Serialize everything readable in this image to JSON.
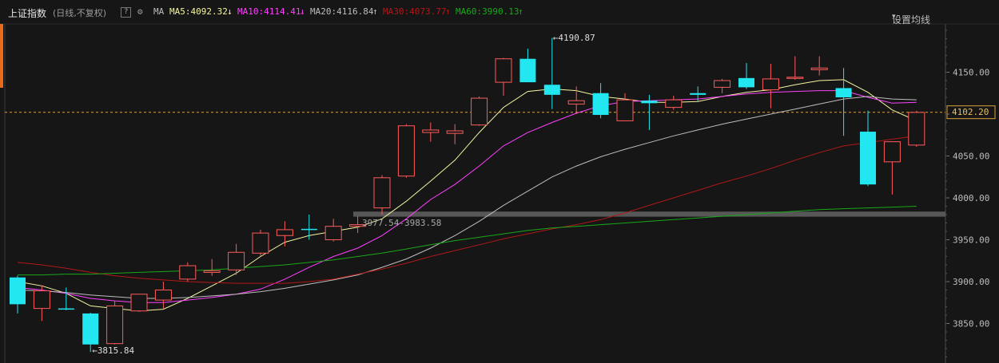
{
  "header": {
    "index_name": "上证指数",
    "mode": "(日线,不复权)",
    "help": "?",
    "ma_label": "MA",
    "ma5": {
      "text": "MA5:4092.32",
      "arrow": "↓",
      "color": "#f5f5a0"
    },
    "ma10": {
      "text": "MA10:4114.41",
      "arrow": "↓",
      "color": "#ff40ff"
    },
    "ma20": {
      "text": "MA20:4116.84",
      "arrow": "↑",
      "color": "#bdbdbd"
    },
    "ma30": {
      "text": "MA30:4073.77",
      "arrow": "↑",
      "color": "#b01818"
    },
    "ma60": {
      "text": "MA60:3990.13",
      "arrow": "↑",
      "color": "#18a818"
    },
    "settings": "设置均线"
  },
  "annotations": {
    "high": "4190.87",
    "low": "3815.84",
    "band": "3977.54-3983.58",
    "current": "4102.20"
  },
  "chart_data": {
    "type": "candlestick",
    "title": "上证指数",
    "ylim": [
      3800,
      4210
    ],
    "yticks": [
      3850,
      3900,
      3950,
      4000,
      4050,
      4100,
      4150
    ],
    "ytick_labels": [
      "3850.00",
      "3900.00",
      "3950.00",
      "4000.00",
      "4050.00",
      "",
      "4150.00"
    ],
    "current_price": 4102.2,
    "band": [
      3977.54,
      3983.58
    ],
    "high_marker": {
      "index": 22,
      "value": 4190.87
    },
    "low_marker": {
      "index": 3,
      "value": 3815.84
    },
    "candles": [
      {
        "o": 3905,
        "h": 3907,
        "l": 3862,
        "c": 3873
      },
      {
        "o": 3868,
        "h": 3895,
        "l": 3853,
        "c": 3889
      },
      {
        "o": 3868,
        "h": 3893,
        "l": 3866,
        "c": 3867
      },
      {
        "o": 3862,
        "h": 3863,
        "l": 3816,
        "c": 3825
      },
      {
        "o": 3826,
        "h": 3877,
        "l": 3825,
        "c": 3871
      },
      {
        "o": 3865,
        "h": 3885,
        "l": 3864,
        "c": 3885
      },
      {
        "o": 3878,
        "h": 3900,
        "l": 3868,
        "c": 3890
      },
      {
        "o": 3903,
        "h": 3923,
        "l": 3900,
        "c": 3919
      },
      {
        "o": 3911,
        "h": 3927,
        "l": 3907,
        "c": 3913
      },
      {
        "o": 3914,
        "h": 3945,
        "l": 3908,
        "c": 3935
      },
      {
        "o": 3934,
        "h": 3962,
        "l": 3931,
        "c": 3958
      },
      {
        "o": 3955,
        "h": 3972,
        "l": 3942,
        "c": 3962
      },
      {
        "o": 3963,
        "h": 3980,
        "l": 3950,
        "c": 3962
      },
      {
        "o": 3950,
        "h": 3975,
        "l": 3948,
        "c": 3966
      },
      {
        "o": 3966,
        "h": 3978,
        "l": 3958,
        "c": 3968
      },
      {
        "o": 3988,
        "h": 4027,
        "l": 3980,
        "c": 4024
      },
      {
        "o": 4026,
        "h": 4088,
        "l": 4024,
        "c": 4086
      },
      {
        "o": 4078,
        "h": 4090,
        "l": 4067,
        "c": 4081
      },
      {
        "o": 4077,
        "h": 4088,
        "l": 4064,
        "c": 4080
      },
      {
        "o": 4087,
        "h": 4121,
        "l": 4086,
        "c": 4119
      },
      {
        "o": 4138,
        "h": 4167,
        "l": 4122,
        "c": 4166
      },
      {
        "o": 4166,
        "h": 4178,
        "l": 4138,
        "c": 4138
      },
      {
        "o": 4135,
        "h": 4191,
        "l": 4106,
        "c": 4123
      },
      {
        "o": 4112,
        "h": 4133,
        "l": 4100,
        "c": 4116
      },
      {
        "o": 4125,
        "h": 4137,
        "l": 4095,
        "c": 4099
      },
      {
        "o": 4092,
        "h": 4125,
        "l": 4092,
        "c": 4117
      },
      {
        "o": 4116,
        "h": 4123,
        "l": 4081,
        "c": 4113
      },
      {
        "o": 4108,
        "h": 4122,
        "l": 4105,
        "c": 4117
      },
      {
        "o": 4125,
        "h": 4133,
        "l": 4115,
        "c": 4123
      },
      {
        "o": 4132,
        "h": 4142,
        "l": 4125,
        "c": 4140
      },
      {
        "o": 4143,
        "h": 4161,
        "l": 4130,
        "c": 4132
      },
      {
        "o": 4129,
        "h": 4160,
        "l": 4107,
        "c": 4142
      },
      {
        "o": 4143,
        "h": 4169,
        "l": 4141,
        "c": 4144
      },
      {
        "o": 4153,
        "h": 4169,
        "l": 4146,
        "c": 4155
      },
      {
        "o": 4131,
        "h": 4155,
        "l": 4074,
        "c": 4120
      },
      {
        "o": 4079,
        "h": 4104,
        "l": 4014,
        "c": 4016
      },
      {
        "o": 4043,
        "h": 4067,
        "l": 4004,
        "c": 4067
      },
      {
        "o": 4063,
        "h": 4104,
        "l": 4061,
        "c": 4102
      }
    ],
    "ma_series": [
      {
        "name": "MA5",
        "color": "#f5f5a0",
        "values": [
          3900,
          3895,
          3886,
          3871,
          3868,
          3865,
          3867,
          3880,
          3895,
          3910,
          3930,
          3947,
          3955,
          3960,
          3965,
          3975,
          3996,
          4020,
          4045,
          4078,
          4108,
          4127,
          4130,
          4128,
          4121,
          4118,
          4114,
          4114,
          4115,
          4121,
          4126,
          4129,
          4135,
          4140,
          4141,
          4126,
          4105,
          4092
        ]
      },
      {
        "name": "MA10",
        "color": "#ff40ff",
        "values": [
          3893,
          3890,
          3886,
          3880,
          3877,
          3875,
          3875,
          3878,
          3881,
          3885,
          3891,
          3903,
          3917,
          3930,
          3940,
          3955,
          3975,
          3998,
          4016,
          4038,
          4062,
          4078,
          4090,
          4101,
          4110,
          4115,
          4116,
          4117,
          4118,
          4121,
          4124,
          4126,
          4127,
          4128,
          4128,
          4120,
          4113,
          4114
        ]
      },
      {
        "name": "MA20",
        "color": "#bdbdbd",
        "values": [
          3890,
          3889,
          3887,
          3884,
          3882,
          3880,
          3880,
          3881,
          3883,
          3885,
          3888,
          3892,
          3897,
          3902,
          3908,
          3917,
          3927,
          3940,
          3955,
          3972,
          3991,
          4008,
          4025,
          4038,
          4049,
          4058,
          4066,
          4074,
          4081,
          4088,
          4094,
          4100,
          4106,
          4112,
          4118,
          4121,
          4118,
          4117
        ]
      },
      {
        "name": "MA30",
        "color": "#b01818",
        "values": [
          3923,
          3920,
          3916,
          3911,
          3907,
          3904,
          3902,
          3900,
          3899,
          3898,
          3898,
          3898,
          3900,
          3903,
          3909,
          3915,
          3922,
          3930,
          3937,
          3944,
          3951,
          3957,
          3963,
          3968,
          3974,
          3982,
          3991,
          4000,
          4009,
          4018,
          4026,
          4035,
          4045,
          4054,
          4062,
          4066,
          4070,
          4074
        ]
      },
      {
        "name": "MA60",
        "color": "#18a818",
        "values": [
          3908,
          3908,
          3909,
          3909,
          3910,
          3911,
          3912,
          3913,
          3914,
          3916,
          3918,
          3920,
          3923,
          3926,
          3930,
          3934,
          3939,
          3944,
          3949,
          3953,
          3957,
          3961,
          3964,
          3966,
          3968,
          3970,
          3972,
          3974,
          3976,
          3978,
          3980,
          3982,
          3984,
          3986,
          3987,
          3988,
          3989,
          3990
        ]
      }
    ]
  }
}
